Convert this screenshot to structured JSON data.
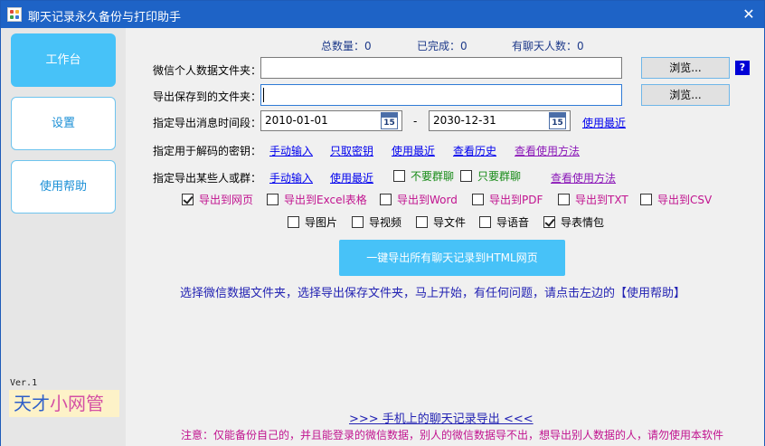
{
  "window": {
    "title": "聊天记录永久备份与打印助手",
    "close_glyph": "✕"
  },
  "sidebar": {
    "items": [
      {
        "label": "工作台",
        "active": true
      },
      {
        "label": "设置",
        "active": false
      },
      {
        "label": "使用帮助",
        "active": false
      }
    ],
    "version": "Ver.1",
    "brand_part1": "天才",
    "brand_part2": "小网管"
  },
  "stats": {
    "total": "总数量：0",
    "done": "已完成：0",
    "contacts": "有聊天人数：0"
  },
  "form": {
    "data_folder_label": "微信个人数据文件夹：",
    "data_folder_value": "",
    "save_folder_label": "导出保存到的文件夹：",
    "save_folder_value": "",
    "browse_label": "浏览...",
    "help_q": "?",
    "time_label": "指定导出消息时间段：",
    "date_from": "2010-01-01",
    "date_to": "2030-12-31",
    "date_sep": "-",
    "calendar_day": "15",
    "recent_time": "使用最近",
    "key_label": "指定用于解码的密钥：",
    "key_links": [
      "手动输入",
      "只取密钥",
      "使用最近",
      "查看历史"
    ],
    "key_help": "查看使用方法",
    "who_label": "指定导出某些人或群：",
    "who_links": [
      "手动输入",
      "使用最近"
    ],
    "no_group": "不要群聊",
    "only_group": "只要群聊",
    "who_help": "查看使用方法"
  },
  "export_formats": [
    {
      "label": "导出到网页",
      "checked": true
    },
    {
      "label": "导出到Excel表格",
      "checked": false
    },
    {
      "label": "导出到Word",
      "checked": false
    },
    {
      "label": "导出到PDF",
      "checked": false
    },
    {
      "label": "导出到TXT",
      "checked": false
    },
    {
      "label": "导出到CSV",
      "checked": false
    }
  ],
  "export_media": [
    {
      "label": "导图片",
      "checked": false
    },
    {
      "label": "导视频",
      "checked": false
    },
    {
      "label": "导文件",
      "checked": false
    },
    {
      "label": "导语音",
      "checked": false
    },
    {
      "label": "导表情包",
      "checked": true
    }
  ],
  "main_button": "一键导出所有聊天记录到HTML网页",
  "instruction": "选择微信数据文件夹，选择导出保存文件夹，马上开始，有任何问题，请点击左边的【使用帮助】",
  "mobile_link": ">>>  手机上的聊天记录导出  <<<",
  "notice": "注意：仅能备份自己的，并且能登录的微信数据，别人的微信数据导不出，想导出别人数据的人，请勿使用本软件",
  "colors": {
    "titlebar": "#1e63c6",
    "accent": "#47c2f8",
    "link": "#0000ee",
    "link_visited": "#8b18b8",
    "magenta": "#c1138f",
    "instruction": "#2323b3"
  }
}
